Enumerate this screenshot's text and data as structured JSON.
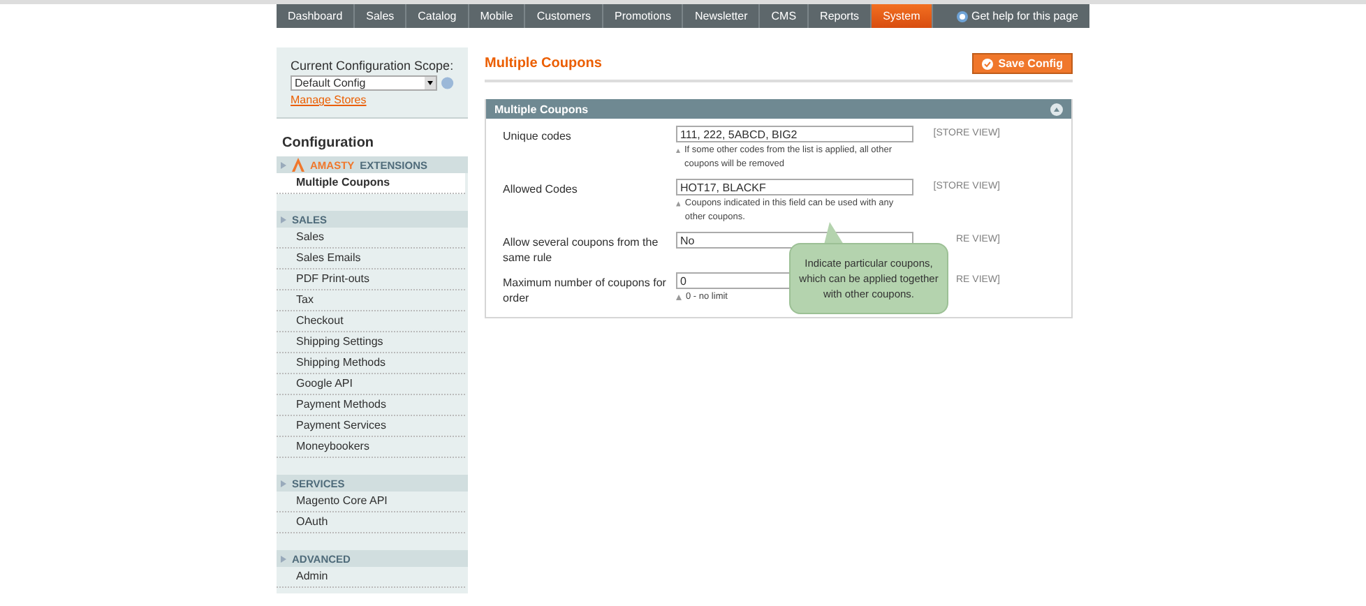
{
  "nav": {
    "items": [
      {
        "label": "Dashboard",
        "selected": false
      },
      {
        "label": "Sales",
        "selected": false
      },
      {
        "label": "Catalog",
        "selected": false
      },
      {
        "label": "Mobile",
        "selected": false
      },
      {
        "label": "Customers",
        "selected": false
      },
      {
        "label": "Promotions",
        "selected": false
      },
      {
        "label": "Newsletter",
        "selected": false
      },
      {
        "label": "CMS",
        "selected": false
      },
      {
        "label": "Reports",
        "selected": false
      },
      {
        "label": "System",
        "selected": true
      }
    ],
    "help": "Get help for this page"
  },
  "scope": {
    "label": "Current Configuration Scope:",
    "value": "Default Config",
    "link": "Manage Stores"
  },
  "sidebar": {
    "title": "Configuration",
    "sections": [
      {
        "title": "EXTENSIONS",
        "brand": "AMASTY",
        "items": [
          {
            "label": "Multiple Coupons",
            "selected": true
          }
        ]
      },
      {
        "title": "SALES",
        "items": [
          {
            "label": "Sales",
            "selected": false
          },
          {
            "label": "Sales Emails",
            "selected": false
          },
          {
            "label": "PDF Print-outs",
            "selected": false
          },
          {
            "label": "Tax",
            "selected": false
          },
          {
            "label": "Checkout",
            "selected": false
          },
          {
            "label": "Shipping Settings",
            "selected": false
          },
          {
            "label": "Shipping Methods",
            "selected": false
          },
          {
            "label": "Google API",
            "selected": false
          },
          {
            "label": "Payment Methods",
            "selected": false
          },
          {
            "label": "Payment Services",
            "selected": false
          },
          {
            "label": "Moneybookers",
            "selected": false
          }
        ]
      },
      {
        "title": "SERVICES",
        "items": [
          {
            "label": "Magento Core API",
            "selected": false
          },
          {
            "label": "OAuth",
            "selected": false
          }
        ]
      },
      {
        "title": "ADVANCED",
        "items": [
          {
            "label": "Admin",
            "selected": false
          }
        ]
      }
    ]
  },
  "main": {
    "title": "Multiple Coupons",
    "save_button": "Save Config",
    "section": {
      "title": "Multiple Coupons",
      "expanded": true,
      "fields": [
        {
          "label": "Unique codes",
          "value": "111, 222, 5ABCD, BIG2",
          "note": "If some other codes from the list is applied, all other coupons will be removed",
          "scope": "[STORE VIEW]"
        },
        {
          "label": "Allowed Codes",
          "value": "HOT17, BLACKF",
          "note": "Coupons indicated in this field can be used with any other coupons.",
          "scope": "[STORE VIEW]"
        },
        {
          "label": "Allow several coupons from the same rule",
          "value": "No",
          "scope": "RE VIEW]"
        },
        {
          "label": "Maximum number of coupons for order",
          "value": "0",
          "note": "0 - no limit",
          "scope": "RE VIEW]"
        }
      ]
    }
  },
  "callout": "Indicate particular coupons, which can be applied together with other coupons."
}
